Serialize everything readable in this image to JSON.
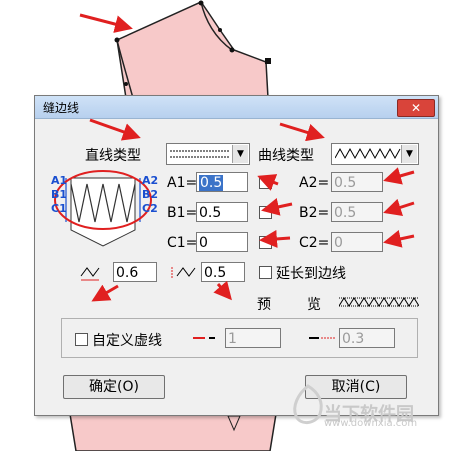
{
  "dialog": {
    "title": "缝边线",
    "close_glyph": "✕"
  },
  "straight_type": {
    "label": "直线类型"
  },
  "curve_type": {
    "label": "曲线类型"
  },
  "preview_labels": {
    "A1": "A1",
    "A2": "A2",
    "B1": "B1",
    "B2": "B2",
    "C1": "C1",
    "C2": "C2"
  },
  "fields": {
    "a1": {
      "label": "A1=",
      "value": "0.5"
    },
    "b1": {
      "label": "B1=",
      "value": "0.5"
    },
    "c1": {
      "label": "C1=",
      "value": "0"
    },
    "a2": {
      "label": "A2=",
      "value": "0.5"
    },
    "b2": {
      "label": "B2=",
      "value": "0.5"
    },
    "c2": {
      "label": "C2=",
      "value": "0"
    },
    "zigzag_width": {
      "value": "0.6"
    },
    "zigzag_spacing": {
      "value": "0.5"
    }
  },
  "extend_to_edge": {
    "label": "延长到边线"
  },
  "preview": {
    "label1": "预",
    "label2": "览"
  },
  "custom_dash": {
    "label": "自定义虚线",
    "dash_value": "1",
    "gap_value": "0.3"
  },
  "buttons": {
    "ok": "确定(O)",
    "cancel": "取消(C)"
  },
  "watermark": {
    "name": "当下软件园",
    "url": "www.downxia.com"
  },
  "colors": {
    "pattern_fill": "#f7c9c9",
    "annotation_red": "#e02020",
    "selection_blue": "#3b73c8"
  }
}
